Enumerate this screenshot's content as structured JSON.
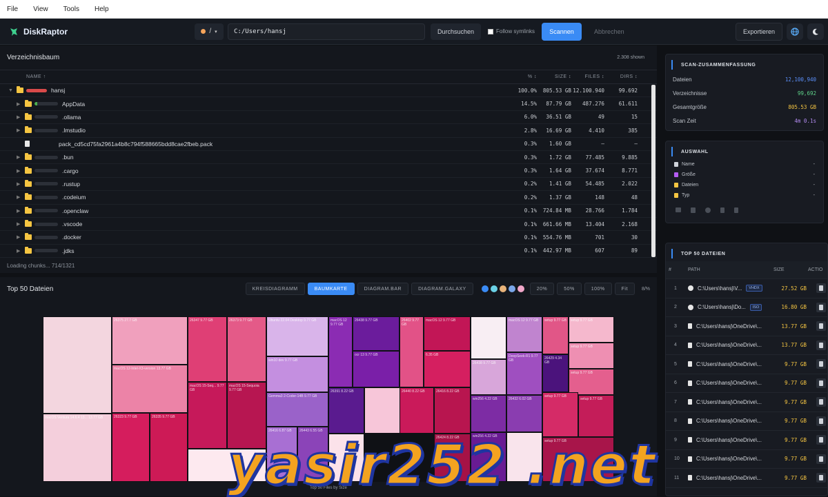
{
  "menu": [
    "File",
    "View",
    "Tools",
    "Help"
  ],
  "toolbar": {
    "app_name": "DiskRaptor",
    "path_value": "C:/Users/hansj",
    "path_root": "/",
    "browse": "Durchsuchen",
    "follow_symlinks": "Follow symlinks",
    "scan": "Scannen",
    "cancel": "Abbrechen",
    "export": "Exportieren"
  },
  "tree": {
    "title": "Verzeichnisbaum",
    "shown": "2.308 shown",
    "headers": {
      "name": "NAME ↑",
      "pct": "% ↕",
      "size": "SIZE ↕",
      "files": "FILES ↕",
      "dirs": "DIRS ↕"
    },
    "rows": [
      {
        "name": "hansj",
        "pct": "100.0%",
        "size": "805.53 GB",
        "files": "12.100.940",
        "dirs": "99.692",
        "kind": "root"
      },
      {
        "name": "AppData",
        "pct": "14.5%",
        "size": "87.79 GB",
        "files": "487.276",
        "dirs": "61.611",
        "kind": "folder"
      },
      {
        "name": ".ollama",
        "pct": "6.0%",
        "size": "36.51 GB",
        "files": "49",
        "dirs": "15",
        "kind": "folder"
      },
      {
        "name": ".lmstudio",
        "pct": "2.8%",
        "size": "16.69 GB",
        "files": "4.410",
        "dirs": "385",
        "kind": "folder"
      },
      {
        "name": "pack_cd5cd75fa2961a4b8c794f588665bdd8cae2fbeb.pack",
        "pct": "0.3%",
        "size": "1.60 GB",
        "files": "—",
        "dirs": "—",
        "kind": "file"
      },
      {
        "name": ".bun",
        "pct": "0.3%",
        "size": "1.72 GB",
        "files": "77.485",
        "dirs": "9.885",
        "kind": "folder"
      },
      {
        "name": ".cargo",
        "pct": "0.3%",
        "size": "1.64 GB",
        "files": "37.674",
        "dirs": "8.771",
        "kind": "folder"
      },
      {
        "name": ".rustup",
        "pct": "0.2%",
        "size": "1.41 GB",
        "files": "54.485",
        "dirs": "2.022",
        "kind": "folder"
      },
      {
        "name": ".codeium",
        "pct": "0.2%",
        "size": "1.37 GB",
        "files": "148",
        "dirs": "48",
        "kind": "folder"
      },
      {
        "name": ".openclaw",
        "pct": "0.1%",
        "size": "724.84 MB",
        "files": "28.766",
        "dirs": "1.784",
        "kind": "folder"
      },
      {
        "name": ".vscode",
        "pct": "0.1%",
        "size": "661.66 MB",
        "files": "13.404",
        "dirs": "2.168",
        "kind": "folder"
      },
      {
        "name": ".docker",
        "pct": "0.1%",
        "size": "554.76 MB",
        "files": "701",
        "dirs": "30",
        "kind": "folder"
      },
      {
        "name": ".jdks",
        "pct": "0.1%",
        "size": "442.97 MB",
        "files": "607",
        "dirs": "89",
        "kind": "folder"
      }
    ],
    "status": "Loading chunks... 714/1321"
  },
  "chart_panel": {
    "title": "Top 50 Dateien",
    "tabs": [
      "KREISDIAGRAMM",
      "BAUMKARTE",
      "DIAGRAM.BAR",
      "DIAGRAM.GALAXY"
    ],
    "active_tab": "BAUMKARTE",
    "palette": [
      "#3a8bf5",
      "#6ad1e6",
      "#e8b37a",
      "#7aa6e8",
      "#f0a6c8"
    ],
    "zoom": [
      "20%",
      "50%",
      "100%",
      "Fit"
    ],
    "zoom_level": "8/%",
    "caption": "Top 50 Files by Size"
  },
  "summary": {
    "title": "SCAN-ZUSAMMENFASSUNG",
    "rows": [
      {
        "label": "Dateien",
        "value": "12,100,940",
        "color": "#5b8ff9"
      },
      {
        "label": "Verzeichnisse",
        "value": "99,692",
        "color": "#5fd38a"
      },
      {
        "label": "Gesamtgröße",
        "value": "805.53 GB",
        "color": "#f5c542"
      },
      {
        "label": "Scan Zeit",
        "value": "4m 0.1s",
        "color": "#b48cf2"
      }
    ]
  },
  "auswahl": {
    "title": "AUSWAHL",
    "rows": [
      {
        "label": "Name",
        "value": "-"
      },
      {
        "label": "Größe",
        "value": "-"
      },
      {
        "label": "Dateien",
        "value": "-"
      },
      {
        "label": "Typ",
        "value": "-"
      }
    ]
  },
  "top50": {
    "title": "TOP 50 DATEIEN",
    "headers": {
      "idx": "#",
      "path": "PATH",
      "size": "SIZE",
      "actions": "ACTIO"
    },
    "rows": [
      {
        "idx": "1",
        "path": "C:\\Users\\hansj\\V...",
        "badge": "VHDX",
        "size": "27.52 GB",
        "disc": true
      },
      {
        "idx": "2",
        "path": "C:\\Users\\hansj\\Do...",
        "badge": "ISO",
        "size": "16.80 GB",
        "disc": true
      },
      {
        "idx": "3",
        "path": "C:\\Users\\hansj\\OneDrive\\...",
        "badge": "",
        "size": "13.77 GB",
        "disc": false
      },
      {
        "idx": "4",
        "path": "C:\\Users\\hansj\\OneDrive\\...",
        "badge": "",
        "size": "13.77 GB",
        "disc": false
      },
      {
        "idx": "5",
        "path": "C:\\Users\\hansj\\OneDrive\\...",
        "badge": "",
        "size": "9.77 GB",
        "disc": false
      },
      {
        "idx": "6",
        "path": "C:\\Users\\hansj\\OneDrive\\...",
        "badge": "",
        "size": "9.77 GB",
        "disc": false
      },
      {
        "idx": "7",
        "path": "C:\\Users\\hansj\\OneDrive\\...",
        "badge": "",
        "size": "9.77 GB",
        "disc": false
      },
      {
        "idx": "8",
        "path": "C:\\Users\\hansj\\OneDrive\\...",
        "badge": "",
        "size": "9.77 GB",
        "disc": false
      },
      {
        "idx": "9",
        "path": "C:\\Users\\hansj\\OneDrive\\...",
        "badge": "",
        "size": "9.77 GB",
        "disc": false
      },
      {
        "idx": "10",
        "path": "C:\\Users\\hansj\\OneDrive\\...",
        "badge": "",
        "size": "9.77 GB",
        "disc": false
      },
      {
        "idx": "11",
        "path": "C:\\Users\\hansj\\OneDrive\\...",
        "badge": "",
        "size": "9.77 GB",
        "disc": false
      }
    ]
  },
  "treemap": [
    {
      "label": "",
      "color": "#f3d6df"
    },
    {
      "label": "26375 27.7 GB",
      "color": "#f0a0bd"
    },
    {
      "label": "macOS 12-Intel-X3-version 13.77 GB",
      "color": "#ec83a7"
    },
    {
      "label": "26347 9.77 GB",
      "color": "#df3f75"
    },
    {
      "label": "26373 9.77 GB",
      "color": "#e45a88"
    },
    {
      "label": "macOS Ventura 14.6.4 13... 13.77 GB",
      "color": "#f4cfdc"
    },
    {
      "label": "26323 9.77 GB",
      "color": "#d51d5d"
    },
    {
      "label": "26335 9.77 GB",
      "color": "#cd1a56"
    },
    {
      "label": "macOS 15-Seq... 9.77 GB",
      "color": "#c6195a"
    },
    {
      "label": "macOS 15-Sequoia 9.77 GB",
      "color": "#b71651"
    },
    {
      "label": "",
      "color": "#fde9ef"
    },
    {
      "label": "Ubuntu 22.04 Desktop 9.77 GB",
      "color": "#d9b4ea"
    },
    {
      "label": "win10 dev 9.77 GB",
      "color": "#c48fe0"
    },
    {
      "label": "Gemma3 2-Coder-14B 9.77 GB",
      "color": "#9a62c9"
    },
    {
      "label": "26416 6.87 GB",
      "color": "#a86fd3"
    },
    {
      "label": "26443 6.55 GB",
      "color": "#8b44b8"
    },
    {
      "label": "macOS 12 9.77 GB",
      "color": "#8b2cb3"
    },
    {
      "label": "26438 9.77 GB",
      "color": "#6b1c9c"
    },
    {
      "label": "ocr 13 9.77 GB",
      "color": "#7a1fa8"
    },
    {
      "label": "26391 8.22 GB",
      "color": "#5a1b8f"
    },
    {
      "label": "",
      "color": "#f7c6d9"
    },
    {
      "label": "",
      "color": "#fbe2ea"
    },
    {
      "label": "26402 9.77 GB",
      "color": "#e25287"
    },
    {
      "label": "macOS 12 9.77 GB",
      "color": "#c21656"
    },
    {
      "label": "6.35 GB",
      "color": "#d51f60"
    },
    {
      "label": "26440 8.22 GB",
      "color": "#ca1a5a"
    },
    {
      "label": "26416 8.22 GB",
      "color": "#b8154f"
    },
    {
      "label": "26424 8.22 GB",
      "color": "#a51246"
    },
    {
      "label": "",
      "color": "#f8eef3"
    },
    {
      "label": "26438 9.77 GB",
      "color": "#d8a6da"
    },
    {
      "label": "macOS 12 9.77 GB",
      "color": "#c084cf"
    },
    {
      "label": "DeepSeek-R1 9.77 GB",
      "color": "#9f4fc0"
    },
    {
      "label": "win256 4.22 GB",
      "color": "#7d2ca4"
    },
    {
      "label": "win256 4.22 GB",
      "color": "#691b93"
    },
    {
      "label": "26432 6.02 GB",
      "color": "#8a3db0"
    },
    {
      "label": "",
      "color": "#f9e4ec"
    },
    {
      "label": "setup 9.77 GB",
      "color": "#e15687"
    },
    {
      "label": "26429 4.34 GB",
      "color": "#4b137c"
    },
    {
      "label": "setup 9.77 GB",
      "color": "#f5b8cd"
    },
    {
      "label": "setup 9.77 GB",
      "color": "#ee8fb2"
    },
    {
      "label": "setup 9.77 GB",
      "color": "#e45f8e"
    },
    {
      "label": "setup 9.77 GB",
      "color": "#d52b67"
    },
    {
      "label": "setup 9.77 GB",
      "color": "#c41d59"
    },
    {
      "label": "setup 9.77 GB",
      "color": "#a8154a"
    }
  ],
  "watermark": "yasir252 .net"
}
